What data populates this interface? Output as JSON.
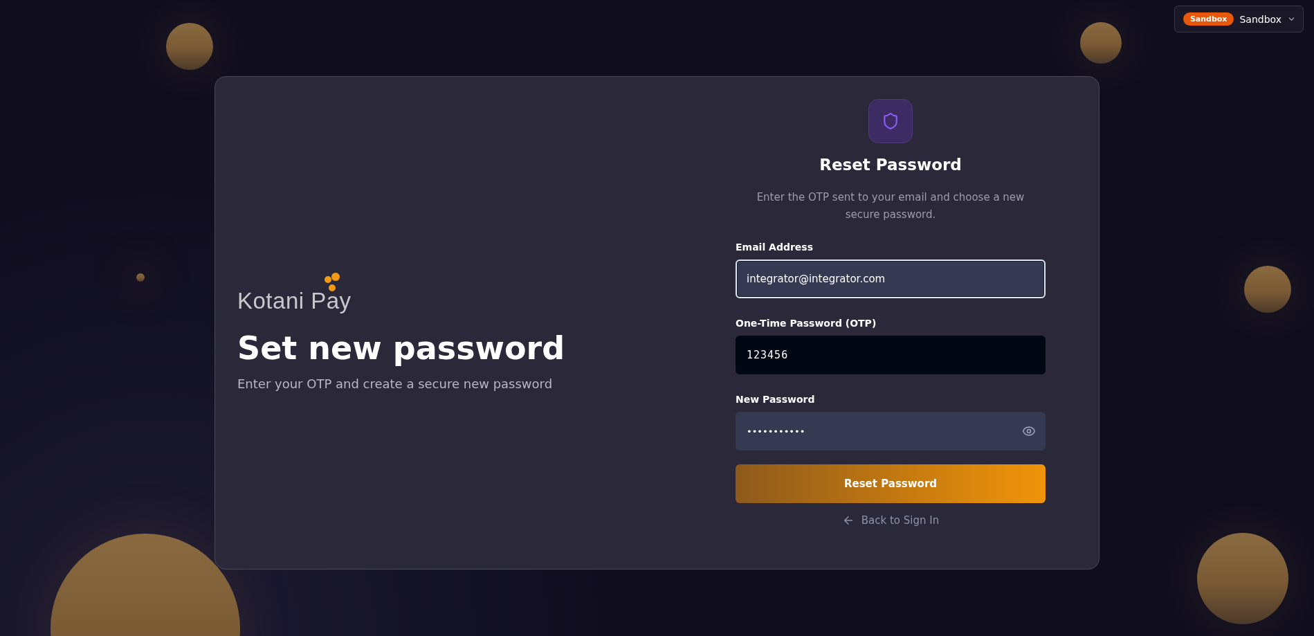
{
  "environment": {
    "badge": "Sandbox",
    "label": "Sandbox"
  },
  "brand": {
    "name": "Kotani Pay"
  },
  "hero": {
    "title": "Set new password",
    "subtitle": "Enter your OTP and create a secure new password"
  },
  "form": {
    "title": "Reset Password",
    "description": "Enter the OTP sent to your email and choose a new secure password.",
    "fields": [
      {
        "kind": "text",
        "label": "Email Address",
        "value": "integrator@integrator.com",
        "focused": true
      },
      {
        "kind": "otp",
        "label": "One-Time Password (OTP)",
        "value": "123456",
        "focused": false
      },
      {
        "kind": "password",
        "label": "New Password",
        "value": "•••••••••••",
        "focused": false
      }
    ],
    "submit": "Reset Password",
    "back_link": "Back to Sign In"
  }
}
